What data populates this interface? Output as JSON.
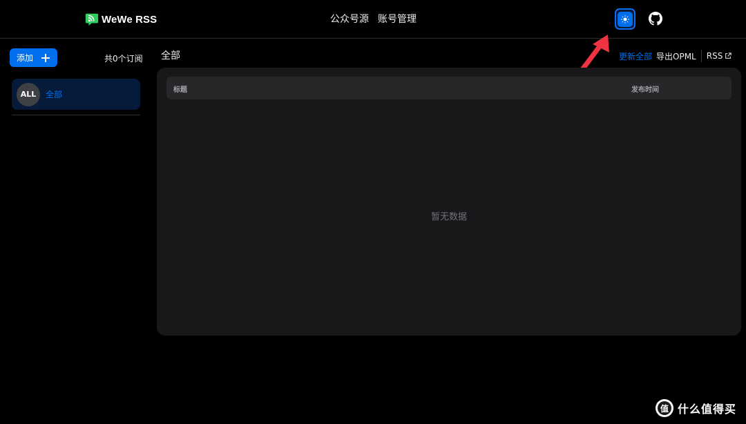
{
  "brand": {
    "name": "WeWe RSS",
    "logo_icon": "rss-chat-logo-icon"
  },
  "nav": {
    "links": [
      "公众号源",
      "账号管理"
    ]
  },
  "topbar": {
    "theme_icon": "sun-icon",
    "github_icon": "github-icon"
  },
  "sidebar": {
    "add_label": "添加",
    "subscription_count": "共0个订阅",
    "feeds": [
      {
        "avatar": "ALL",
        "name": "全部"
      }
    ]
  },
  "main": {
    "title": "全部",
    "actions": {
      "update_all": "更新全部",
      "export_opml": "导出OPML",
      "rss": "RSS"
    },
    "table": {
      "columns": [
        "标题",
        "发布时间"
      ],
      "empty_text": "暂无数据"
    }
  },
  "watermark": {
    "badge": "值",
    "text": "什么值得买"
  },
  "colors": {
    "accent": "#006FEE",
    "background": "#000000",
    "card": "#18181b",
    "annotation": "#ef3340"
  }
}
